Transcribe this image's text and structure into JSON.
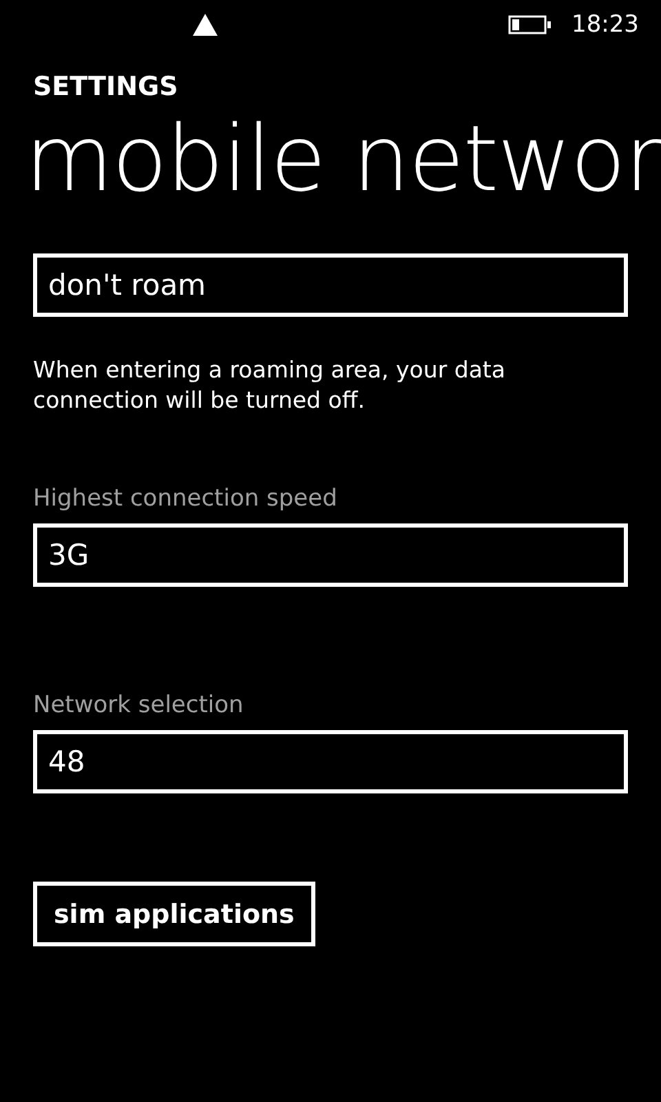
{
  "status_bar": {
    "time": "18:23"
  },
  "header": {
    "app_title": "SETTINGS",
    "page_title": "mobile networ"
  },
  "settings": [
    {
      "kind": "picker",
      "value": "don't roam",
      "note": "When entering a roaming area, your data connection will be turned off."
    },
    {
      "kind": "picker",
      "label": "Highest connection speed",
      "value": "3G"
    },
    {
      "kind": "picker",
      "label": "Network selection",
      "value": "48"
    },
    {
      "kind": "button",
      "label": "sim applications"
    }
  ]
}
